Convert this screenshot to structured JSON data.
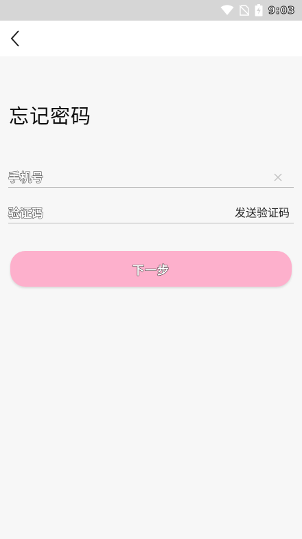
{
  "status_bar": {
    "time": "9:03",
    "icons": [
      "wifi-icon",
      "no-sim-icon",
      "battery-charging-icon"
    ]
  },
  "nav": {
    "back_icon": "chevron-left-icon"
  },
  "page": {
    "title": "忘记密码"
  },
  "form": {
    "phone": {
      "label": "手机号",
      "value": "",
      "clear_icon": "close-icon"
    },
    "code": {
      "label": "验证码",
      "value": "",
      "send_label": "发送验证码"
    },
    "next_label": "下一步"
  },
  "colors": {
    "status_bar_bg": "#d6d6d6",
    "page_bg": "#f7f7f7",
    "nav_bg": "#ffffff",
    "button_bg": "#fdb0cc",
    "divider": "#b9b9b9"
  }
}
